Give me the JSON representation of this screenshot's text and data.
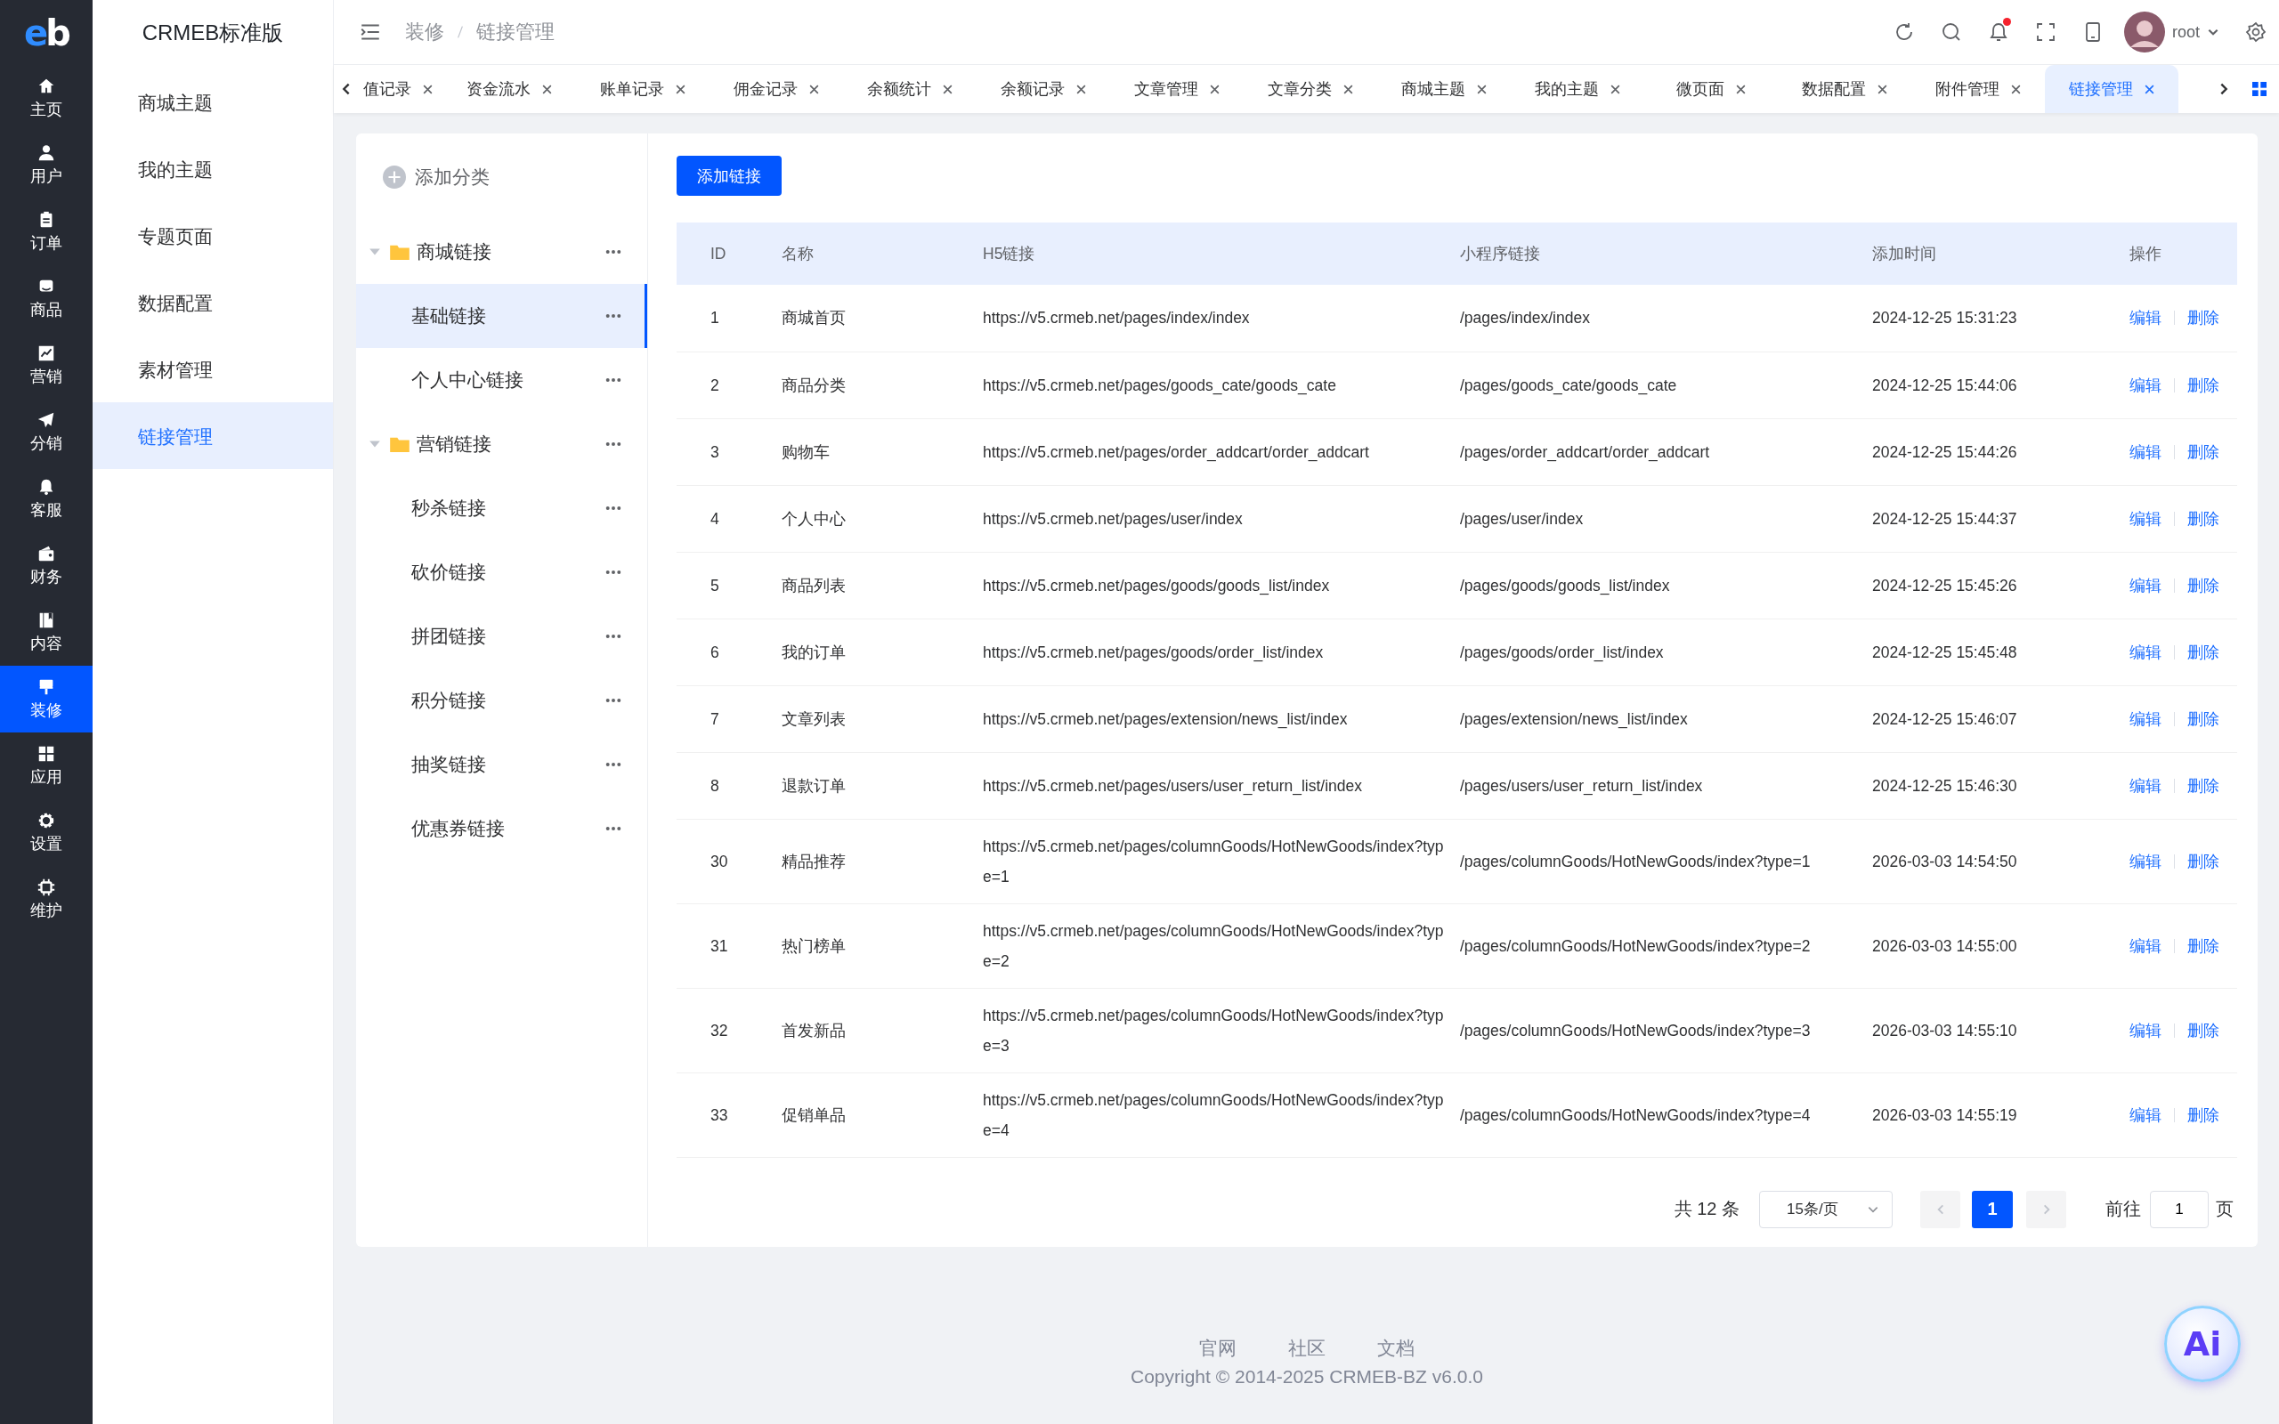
{
  "logo": "eb",
  "rail": [
    {
      "label": "主页",
      "kind": "home",
      "selected": false
    },
    {
      "label": "用户",
      "kind": "user",
      "selected": false
    },
    {
      "label": "订单",
      "kind": "order",
      "selected": false
    },
    {
      "label": "商品",
      "kind": "goods",
      "selected": false
    },
    {
      "label": "营销",
      "kind": "chart",
      "selected": false
    },
    {
      "label": "分销",
      "kind": "send",
      "selected": false
    },
    {
      "label": "客服",
      "kind": "bell",
      "selected": false
    },
    {
      "label": "财务",
      "kind": "wallet",
      "selected": false
    },
    {
      "label": "内容",
      "kind": "book",
      "selected": false
    },
    {
      "label": "装修",
      "kind": "brush",
      "selected": true
    },
    {
      "label": "应用",
      "kind": "grid",
      "selected": false
    },
    {
      "label": "设置",
      "kind": "gear",
      "selected": false
    },
    {
      "label": "维护",
      "kind": "chip",
      "selected": false
    }
  ],
  "brand": "CRMEB标准版",
  "submenu": [
    {
      "label": "商城主题",
      "selected": false
    },
    {
      "label": "我的主题",
      "selected": false
    },
    {
      "label": "专题页面",
      "selected": false
    },
    {
      "label": "数据配置",
      "selected": false
    },
    {
      "label": "素材管理",
      "selected": false
    },
    {
      "label": "链接管理",
      "selected": true
    }
  ],
  "header": {
    "breadcrumb": [
      "装修",
      "链接管理"
    ],
    "user": "root",
    "unread": true
  },
  "tabs": [
    {
      "label": "值记录",
      "selected": false
    },
    {
      "label": "资金流水",
      "selected": false
    },
    {
      "label": "账单记录",
      "selected": false
    },
    {
      "label": "佣金记录",
      "selected": false
    },
    {
      "label": "余额统计",
      "selected": false
    },
    {
      "label": "余额记录",
      "selected": false
    },
    {
      "label": "文章管理",
      "selected": false
    },
    {
      "label": "文章分类",
      "selected": false
    },
    {
      "label": "商城主题",
      "selected": false
    },
    {
      "label": "我的主题",
      "selected": false
    },
    {
      "label": "微页面",
      "selected": false
    },
    {
      "label": "数据配置",
      "selected": false
    },
    {
      "label": "附件管理",
      "selected": false
    },
    {
      "label": "链接管理",
      "selected": true
    }
  ],
  "add_category": "添加分类",
  "tree": [
    {
      "label": "商城链接",
      "expanded": true,
      "selected": false,
      "children": [
        {
          "label": "基础链接",
          "selected": true
        },
        {
          "label": "个人中心链接",
          "selected": false
        }
      ]
    },
    {
      "label": "营销链接",
      "expanded": true,
      "selected": false,
      "children": [
        {
          "label": "秒杀链接",
          "selected": false
        },
        {
          "label": "砍价链接",
          "selected": false
        },
        {
          "label": "拼团链接",
          "selected": false
        },
        {
          "label": "积分链接",
          "selected": false
        },
        {
          "label": "抽奖链接",
          "selected": false
        },
        {
          "label": "优惠券链接",
          "selected": false
        }
      ]
    }
  ],
  "add_button": "添加链接",
  "table": {
    "columns": [
      "ID",
      "名称",
      "H5链接",
      "小程序链接",
      "添加时间",
      "操作"
    ],
    "rows": [
      {
        "id": "1",
        "name": "商城首页",
        "h5": "https://v5.crmeb.net/pages/index/index",
        "mini": "/pages/index/index",
        "time": "2024-12-25 15:31:23",
        "actions": [
          "编辑",
          "删除"
        ]
      },
      {
        "id": "2",
        "name": "商品分类",
        "h5": "https://v5.crmeb.net/pages/goods_cate/goods_cate",
        "mini": "/pages/goods_cate/goods_cate",
        "time": "2024-12-25 15:44:06",
        "actions": [
          "编辑",
          "删除"
        ]
      },
      {
        "id": "3",
        "name": "购物车",
        "h5": "https://v5.crmeb.net/pages/order_addcart/order_addcart",
        "mini": "/pages/order_addcart/order_addcart",
        "time": "2024-12-25 15:44:26",
        "actions": [
          "编辑",
          "删除"
        ]
      },
      {
        "id": "4",
        "name": "个人中心",
        "h5": "https://v5.crmeb.net/pages/user/index",
        "mini": "/pages/user/index",
        "time": "2024-12-25 15:44:37",
        "actions": [
          "编辑",
          "删除"
        ]
      },
      {
        "id": "5",
        "name": "商品列表",
        "h5": "https://v5.crmeb.net/pages/goods/goods_list/index",
        "mini": "/pages/goods/goods_list/index",
        "time": "2024-12-25 15:45:26",
        "actions": [
          "编辑",
          "删除"
        ]
      },
      {
        "id": "6",
        "name": "我的订单",
        "h5": "https://v5.crmeb.net/pages/goods/order_list/index",
        "mini": "/pages/goods/order_list/index",
        "time": "2024-12-25 15:45:48",
        "actions": [
          "编辑",
          "删除"
        ]
      },
      {
        "id": "7",
        "name": "文章列表",
        "h5": "https://v5.crmeb.net/pages/extension/news_list/index",
        "mini": "/pages/extension/news_list/index",
        "time": "2024-12-25 15:46:07",
        "actions": [
          "编辑",
          "删除"
        ]
      },
      {
        "id": "8",
        "name": "退款订单",
        "h5": "https://v5.crmeb.net/pages/users/user_return_list/index",
        "mini": "/pages/users/user_return_list/index",
        "time": "2024-12-25 15:46:30",
        "actions": [
          "编辑",
          "删除"
        ]
      },
      {
        "id": "30",
        "name": "精品推荐",
        "h5": "https://v5.crmeb.net/pages/columnGoods/HotNewGoods/index?type=1",
        "mini": "/pages/columnGoods/HotNewGoods/index?type=1",
        "time": "2026-03-03 14:54:50",
        "actions": [
          "编辑",
          "删除"
        ]
      },
      {
        "id": "31",
        "name": "热门榜单",
        "h5": "https://v5.crmeb.net/pages/columnGoods/HotNewGoods/index?type=2",
        "mini": "/pages/columnGoods/HotNewGoods/index?type=2",
        "time": "2026-03-03 14:55:00",
        "actions": [
          "编辑",
          "删除"
        ]
      },
      {
        "id": "32",
        "name": "首发新品",
        "h5": "https://v5.crmeb.net/pages/columnGoods/HotNewGoods/index?type=3",
        "mini": "/pages/columnGoods/HotNewGoods/index?type=3",
        "time": "2026-03-03 14:55:10",
        "actions": [
          "编辑",
          "删除"
        ]
      },
      {
        "id": "33",
        "name": "促销单品",
        "h5": "https://v5.crmeb.net/pages/columnGoods/HotNewGoods/index?type=4",
        "mini": "/pages/columnGoods/HotNewGoods/index?type=4",
        "time": "2026-03-03 14:55:19",
        "actions": [
          "编辑",
          "删除"
        ]
      }
    ]
  },
  "pagination": {
    "total": "共 12 条",
    "page_size": "15条/页",
    "pages": [
      {
        "label": "1",
        "selected": true
      }
    ],
    "goto_label": "前往",
    "goto_value": "1",
    "page_suffix": "页"
  },
  "footer": {
    "links": [
      "官网",
      "社区",
      "文档"
    ],
    "copyright": "Copyright © 2014-2025 CRMEB-BZ v6.0.0"
  },
  "ai_button": "Ai"
}
